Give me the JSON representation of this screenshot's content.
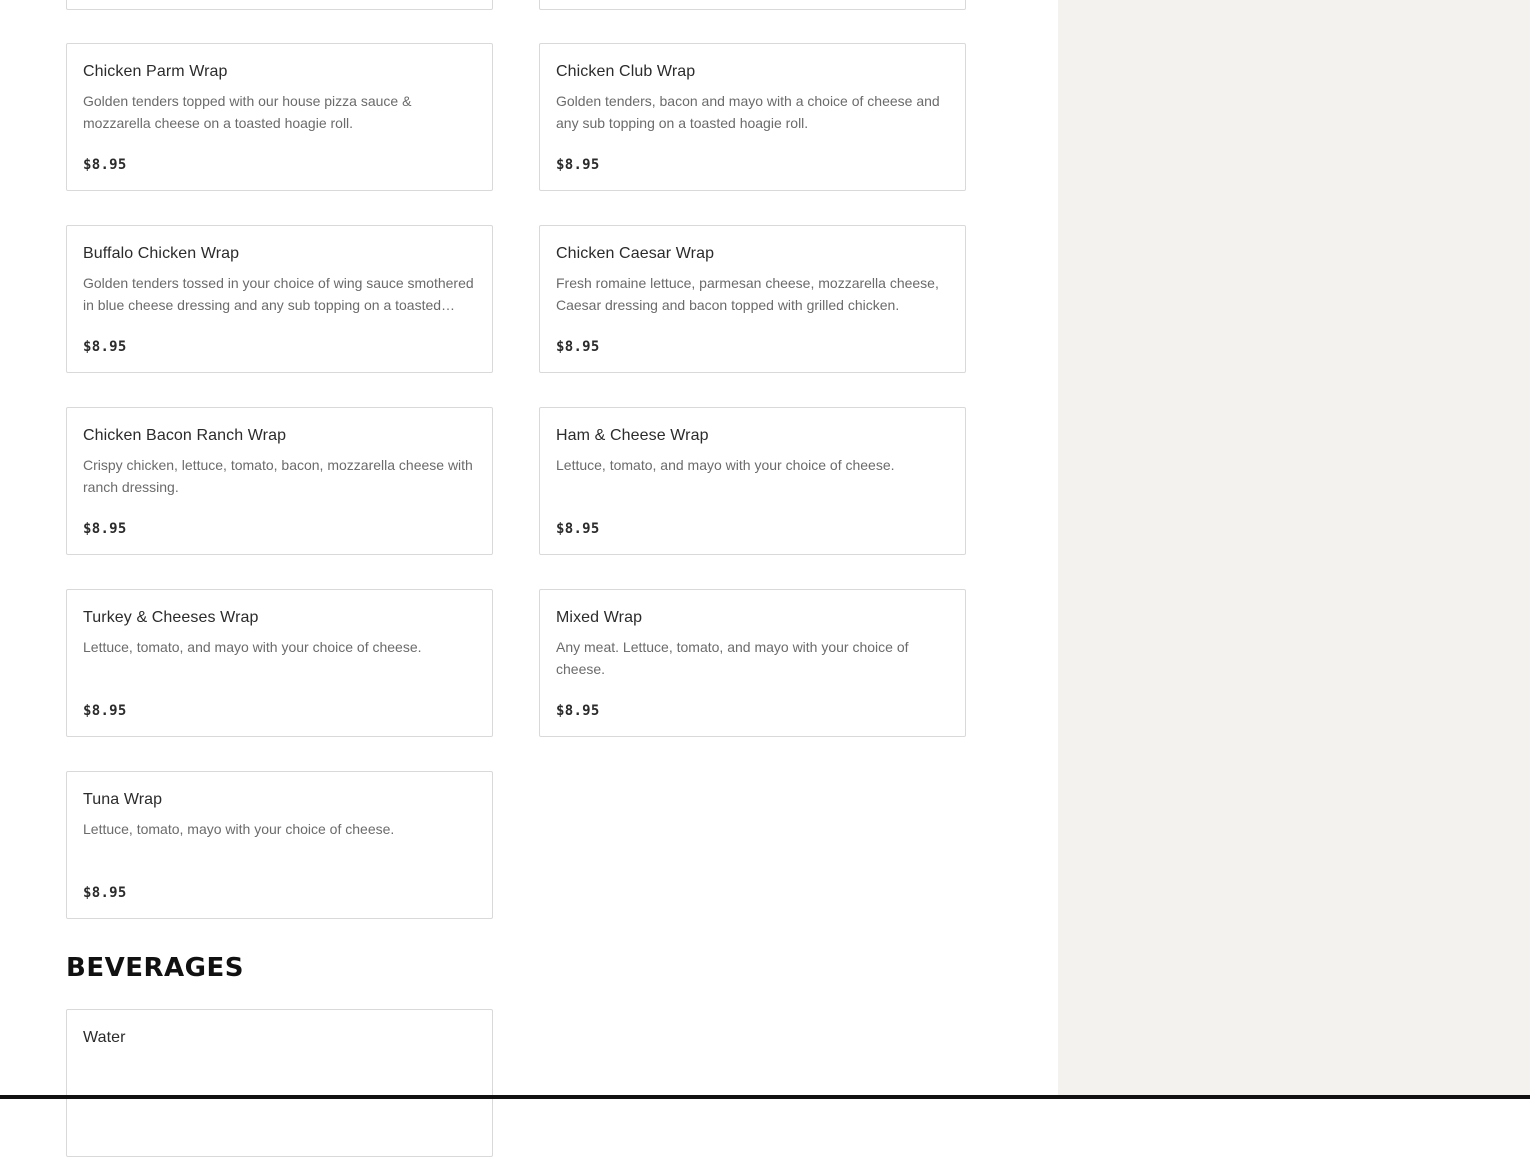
{
  "wraps": [
    {
      "name": "Chicken Parm Wrap",
      "description": "Golden tenders topped with our house pizza sauce & mozzarella cheese on a toasted hoagie roll.",
      "price": "$8.95"
    },
    {
      "name": "Chicken Club Wrap",
      "description": "Golden tenders, bacon and mayo with a choice of cheese and any sub topping on a toasted hoagie roll.",
      "price": "$8.95"
    },
    {
      "name": "Buffalo Chicken Wrap",
      "description": "Golden tenders tossed in your choice of wing sauce smothered in blue cheese dressing and any sub topping on a toasted hoagie roll.",
      "price": "$8.95"
    },
    {
      "name": "Chicken Caesar Wrap",
      "description": "Fresh romaine lettuce, parmesan cheese, mozzarella cheese, Caesar dressing and bacon topped with grilled chicken.",
      "price": "$8.95"
    },
    {
      "name": "Chicken Bacon Ranch Wrap",
      "description": "Crispy chicken, lettuce, tomato, bacon, mozzarella cheese with ranch dressing.",
      "price": "$8.95"
    },
    {
      "name": "Ham & Cheese Wrap",
      "description": "Lettuce, tomato, and mayo with your choice of cheese.",
      "price": "$8.95"
    },
    {
      "name": "Turkey & Cheeses Wrap",
      "description": "Lettuce, tomato, and mayo with your choice of cheese.",
      "price": "$8.95"
    },
    {
      "name": "Mixed Wrap",
      "description": "Any meat. Lettuce, tomato, and mayo with your choice of cheese.",
      "price": "$8.95"
    },
    {
      "name": "Tuna Wrap",
      "description": "Lettuce, tomato, mayo with your choice of cheese.",
      "price": "$8.95"
    }
  ],
  "beverages": {
    "title": "BEVERAGES",
    "items": [
      {
        "name": "Water"
      }
    ]
  },
  "colors": {
    "sidebar_bg": "#f3f2ef",
    "card_border": "#d9d9d9",
    "text_primary": "#2b2b2b",
    "text_secondary": "#6b6b6b"
  }
}
